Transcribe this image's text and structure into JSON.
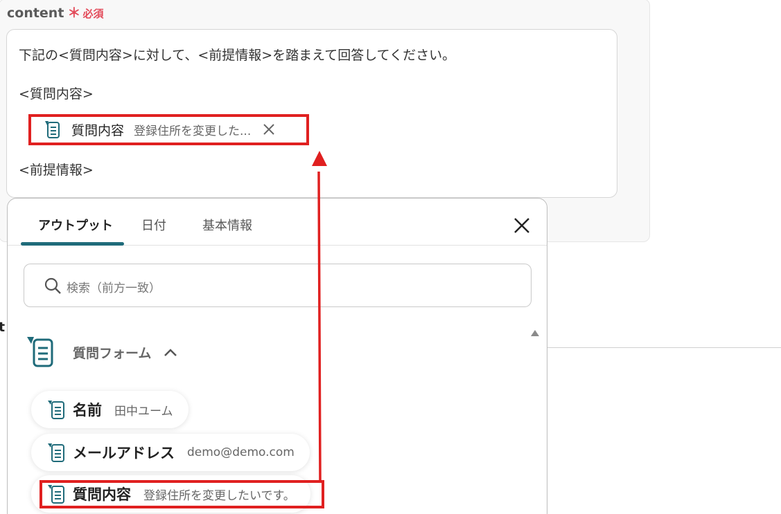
{
  "field": {
    "label": "content",
    "required_mark": "＊",
    "required_text": "必須"
  },
  "content": {
    "line1": "下記の<質問内容>に対して、<前提情報>を踏まえて回答してください。",
    "line2": "<質問内容>",
    "line3": "<前提情報>",
    "chip": {
      "icon": "form-icon",
      "name": "質問内容",
      "value": "登録住所を変更した..."
    }
  },
  "edge_text": "t",
  "popover": {
    "tabs": [
      {
        "label": "アウトプット",
        "active": true
      },
      {
        "label": "日付",
        "active": false
      },
      {
        "label": "基本情報",
        "active": false
      }
    ],
    "search_placeholder": "検索（前方一致）",
    "group": {
      "label": "質問フォーム",
      "icon": "form-icon",
      "expanded": true
    },
    "items": [
      {
        "name": "名前",
        "value": "田中ユーム"
      },
      {
        "name": "メールアドレス",
        "value": "demo@demo.com"
      },
      {
        "name": "質問内容",
        "value": "登録住所を変更したいです。"
      }
    ]
  },
  "colors": {
    "accent": "#1f6b7a",
    "required": "#e34b5a",
    "annotation": "#e02020"
  }
}
